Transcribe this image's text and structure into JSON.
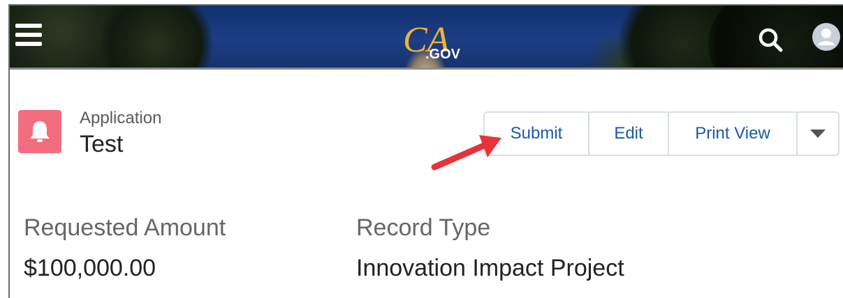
{
  "header": {
    "logo_text": "CA",
    "logo_suffix": ".GOV",
    "icons": {
      "menu": "hamburger-menu-icon",
      "search": "search-icon",
      "avatar": "user-avatar-icon"
    }
  },
  "record": {
    "type_label": "Application",
    "name": "Test",
    "icon": "bell-icon",
    "icon_color": "#f26d7d"
  },
  "actions": {
    "submit": "Submit",
    "edit": "Edit",
    "print_view": "Print View",
    "more_icon": "caret-down-icon"
  },
  "annotation": {
    "arrow_color": "#e8323a"
  },
  "fields": [
    {
      "label": "Requested Amount",
      "value": "$100,000.00"
    },
    {
      "label": "Record Type",
      "value": "Innovation Impact Project"
    }
  ],
  "colors": {
    "link": "#1b5aa6",
    "banner": "#1d3e85"
  }
}
